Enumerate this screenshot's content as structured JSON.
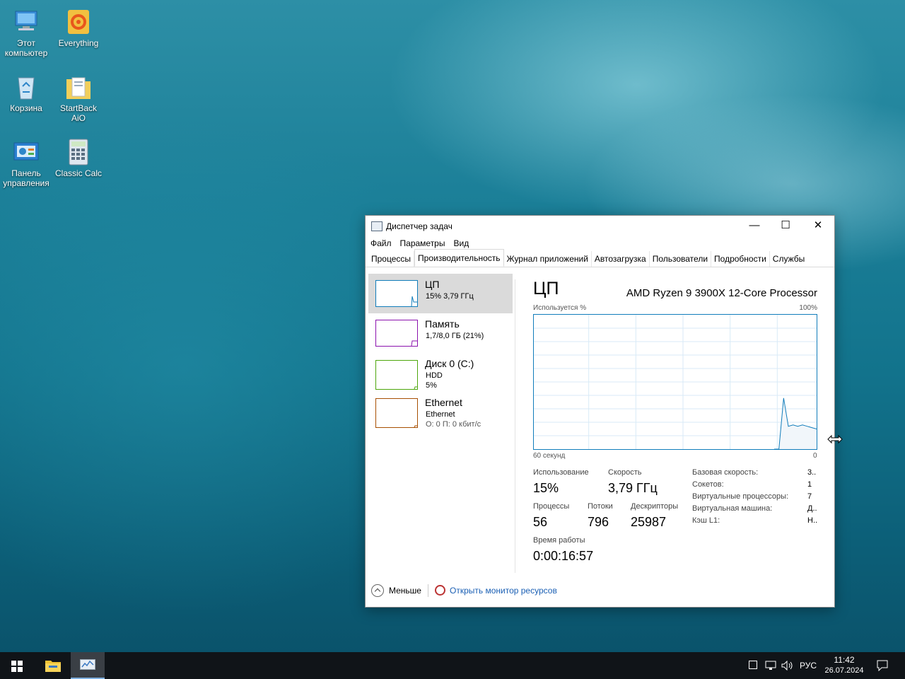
{
  "desktop": {
    "icons": [
      {
        "label": "Этот компьютер",
        "icon": "computer-icon"
      },
      {
        "label": "Everything",
        "icon": "everything-icon"
      },
      {
        "label": "Корзина",
        "icon": "recycle-bin-icon"
      },
      {
        "label": "StartBack AiO",
        "icon": "startback-icon"
      },
      {
        "label": "Панель управления",
        "icon": "control-panel-icon"
      },
      {
        "label": "Classic Calc",
        "icon": "calculator-icon"
      }
    ]
  },
  "window": {
    "title": "Диспетчер задач",
    "controls": {
      "minimize": "—",
      "maximize": "☐",
      "close": "✕"
    },
    "menu": [
      "Файл",
      "Параметры",
      "Вид"
    ],
    "tabs": [
      "Процессы",
      "Производительность",
      "Журнал приложений",
      "Автозагрузка",
      "Пользователи",
      "Подробности",
      "Службы"
    ],
    "active_tab": "Производительность"
  },
  "resources": [
    {
      "name": "ЦП",
      "sub1": "15% 3,79 ГГц",
      "sub2": "",
      "color": "#117dbb"
    },
    {
      "name": "Память",
      "sub1": "1,7/8,0 ГБ (21%)",
      "sub2": "",
      "color": "#8b12ae"
    },
    {
      "name": "Диск 0 (C:)",
      "sub1": "HDD",
      "sub2": "5%",
      "color": "#4da60c"
    },
    {
      "name": "Ethernet",
      "sub1": "Ethernet",
      "sub2": "О: 0 П: 0 кбит/с",
      "color": "#a74f01"
    }
  ],
  "cpu": {
    "title": "ЦП",
    "model": "AMD Ryzen 9 3900X 12-Core Processor",
    "graph_top_left": "Используется %",
    "graph_top_right": "100%",
    "graph_bottom_left": "60 секунд",
    "graph_bottom_right": "0",
    "stats": {
      "usage_label": "Использование",
      "usage_value": "15%",
      "speed_label": "Скорость",
      "speed_value": "3,79 ГГц",
      "processes_label": "Процессы",
      "processes_value": "56",
      "threads_label": "Потоки",
      "threads_value": "796",
      "handles_label": "Дескрипторы",
      "handles_value": "25987",
      "uptime_label": "Время работы",
      "uptime_value": "0:00:16:57"
    },
    "details": [
      {
        "key": "Базовая скорость:",
        "value": "3.."
      },
      {
        "key": "Сокетов:",
        "value": "1"
      },
      {
        "key": "Виртуальные процессоры:",
        "value": "7"
      },
      {
        "key": "Виртуальная машина:",
        "value": "Д.."
      },
      {
        "key": "Кэш L1:",
        "value": "Н.."
      }
    ]
  },
  "footer": {
    "less_label": "Меньше",
    "monitor_label": "Открыть монитор ресурсов"
  },
  "taskbar": {
    "lang": "РУС",
    "time": "11:42",
    "date": "26.07.2024"
  },
  "chart_data": {
    "type": "area",
    "x": [
      60,
      9,
      8,
      7,
      6,
      5,
      4,
      3,
      2,
      1,
      0
    ],
    "values": [
      0,
      0,
      0,
      38,
      17,
      18,
      17,
      18,
      17,
      16,
      15
    ],
    "ylim": [
      0,
      100
    ],
    "xlabel": "60 секунд",
    "ylabel": "Используется %",
    "grid": true
  }
}
